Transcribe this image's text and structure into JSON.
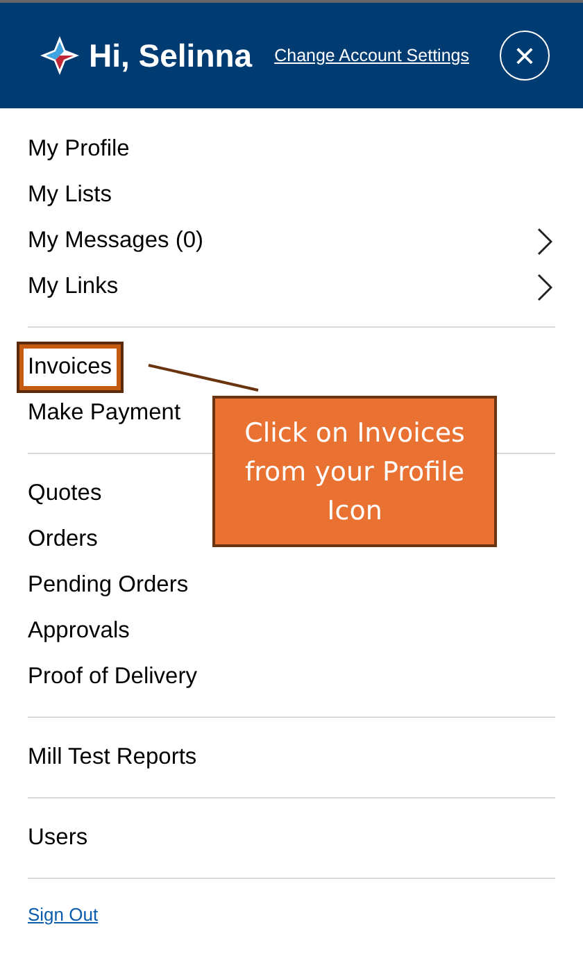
{
  "header": {
    "greeting": "Hi, Selinna",
    "settings_link": "Change Account Settings",
    "close_icon": "×"
  },
  "menu_groups": [
    {
      "items": [
        {
          "label": "My Profile",
          "has_submenu": false,
          "highlighted": false
        },
        {
          "label": "My Lists",
          "has_submenu": false,
          "highlighted": false
        },
        {
          "label": "My Messages (0)",
          "has_submenu": true,
          "highlighted": false
        },
        {
          "label": "My Links",
          "has_submenu": true,
          "highlighted": false
        }
      ]
    },
    {
      "items": [
        {
          "label": "Invoices",
          "has_submenu": false,
          "highlighted": true
        },
        {
          "label": "Make Payment",
          "has_submenu": false,
          "highlighted": false
        }
      ]
    },
    {
      "items": [
        {
          "label": "Quotes",
          "has_submenu": false,
          "highlighted": false
        },
        {
          "label": "Orders",
          "has_submenu": false,
          "highlighted": false
        },
        {
          "label": "Pending Orders",
          "has_submenu": false,
          "highlighted": false
        },
        {
          "label": "Approvals",
          "has_submenu": false,
          "highlighted": false
        },
        {
          "label": "Proof of Delivery",
          "has_submenu": false,
          "highlighted": false
        }
      ]
    },
    {
      "items": [
        {
          "label": "Mill Test Reports",
          "has_submenu": false,
          "highlighted": false
        }
      ]
    },
    {
      "items": [
        {
          "label": "Users",
          "has_submenu": false,
          "highlighted": false
        }
      ]
    }
  ],
  "sign_out": "Sign Out",
  "callout": {
    "text": "Click on Invoices from your Profile Icon"
  }
}
